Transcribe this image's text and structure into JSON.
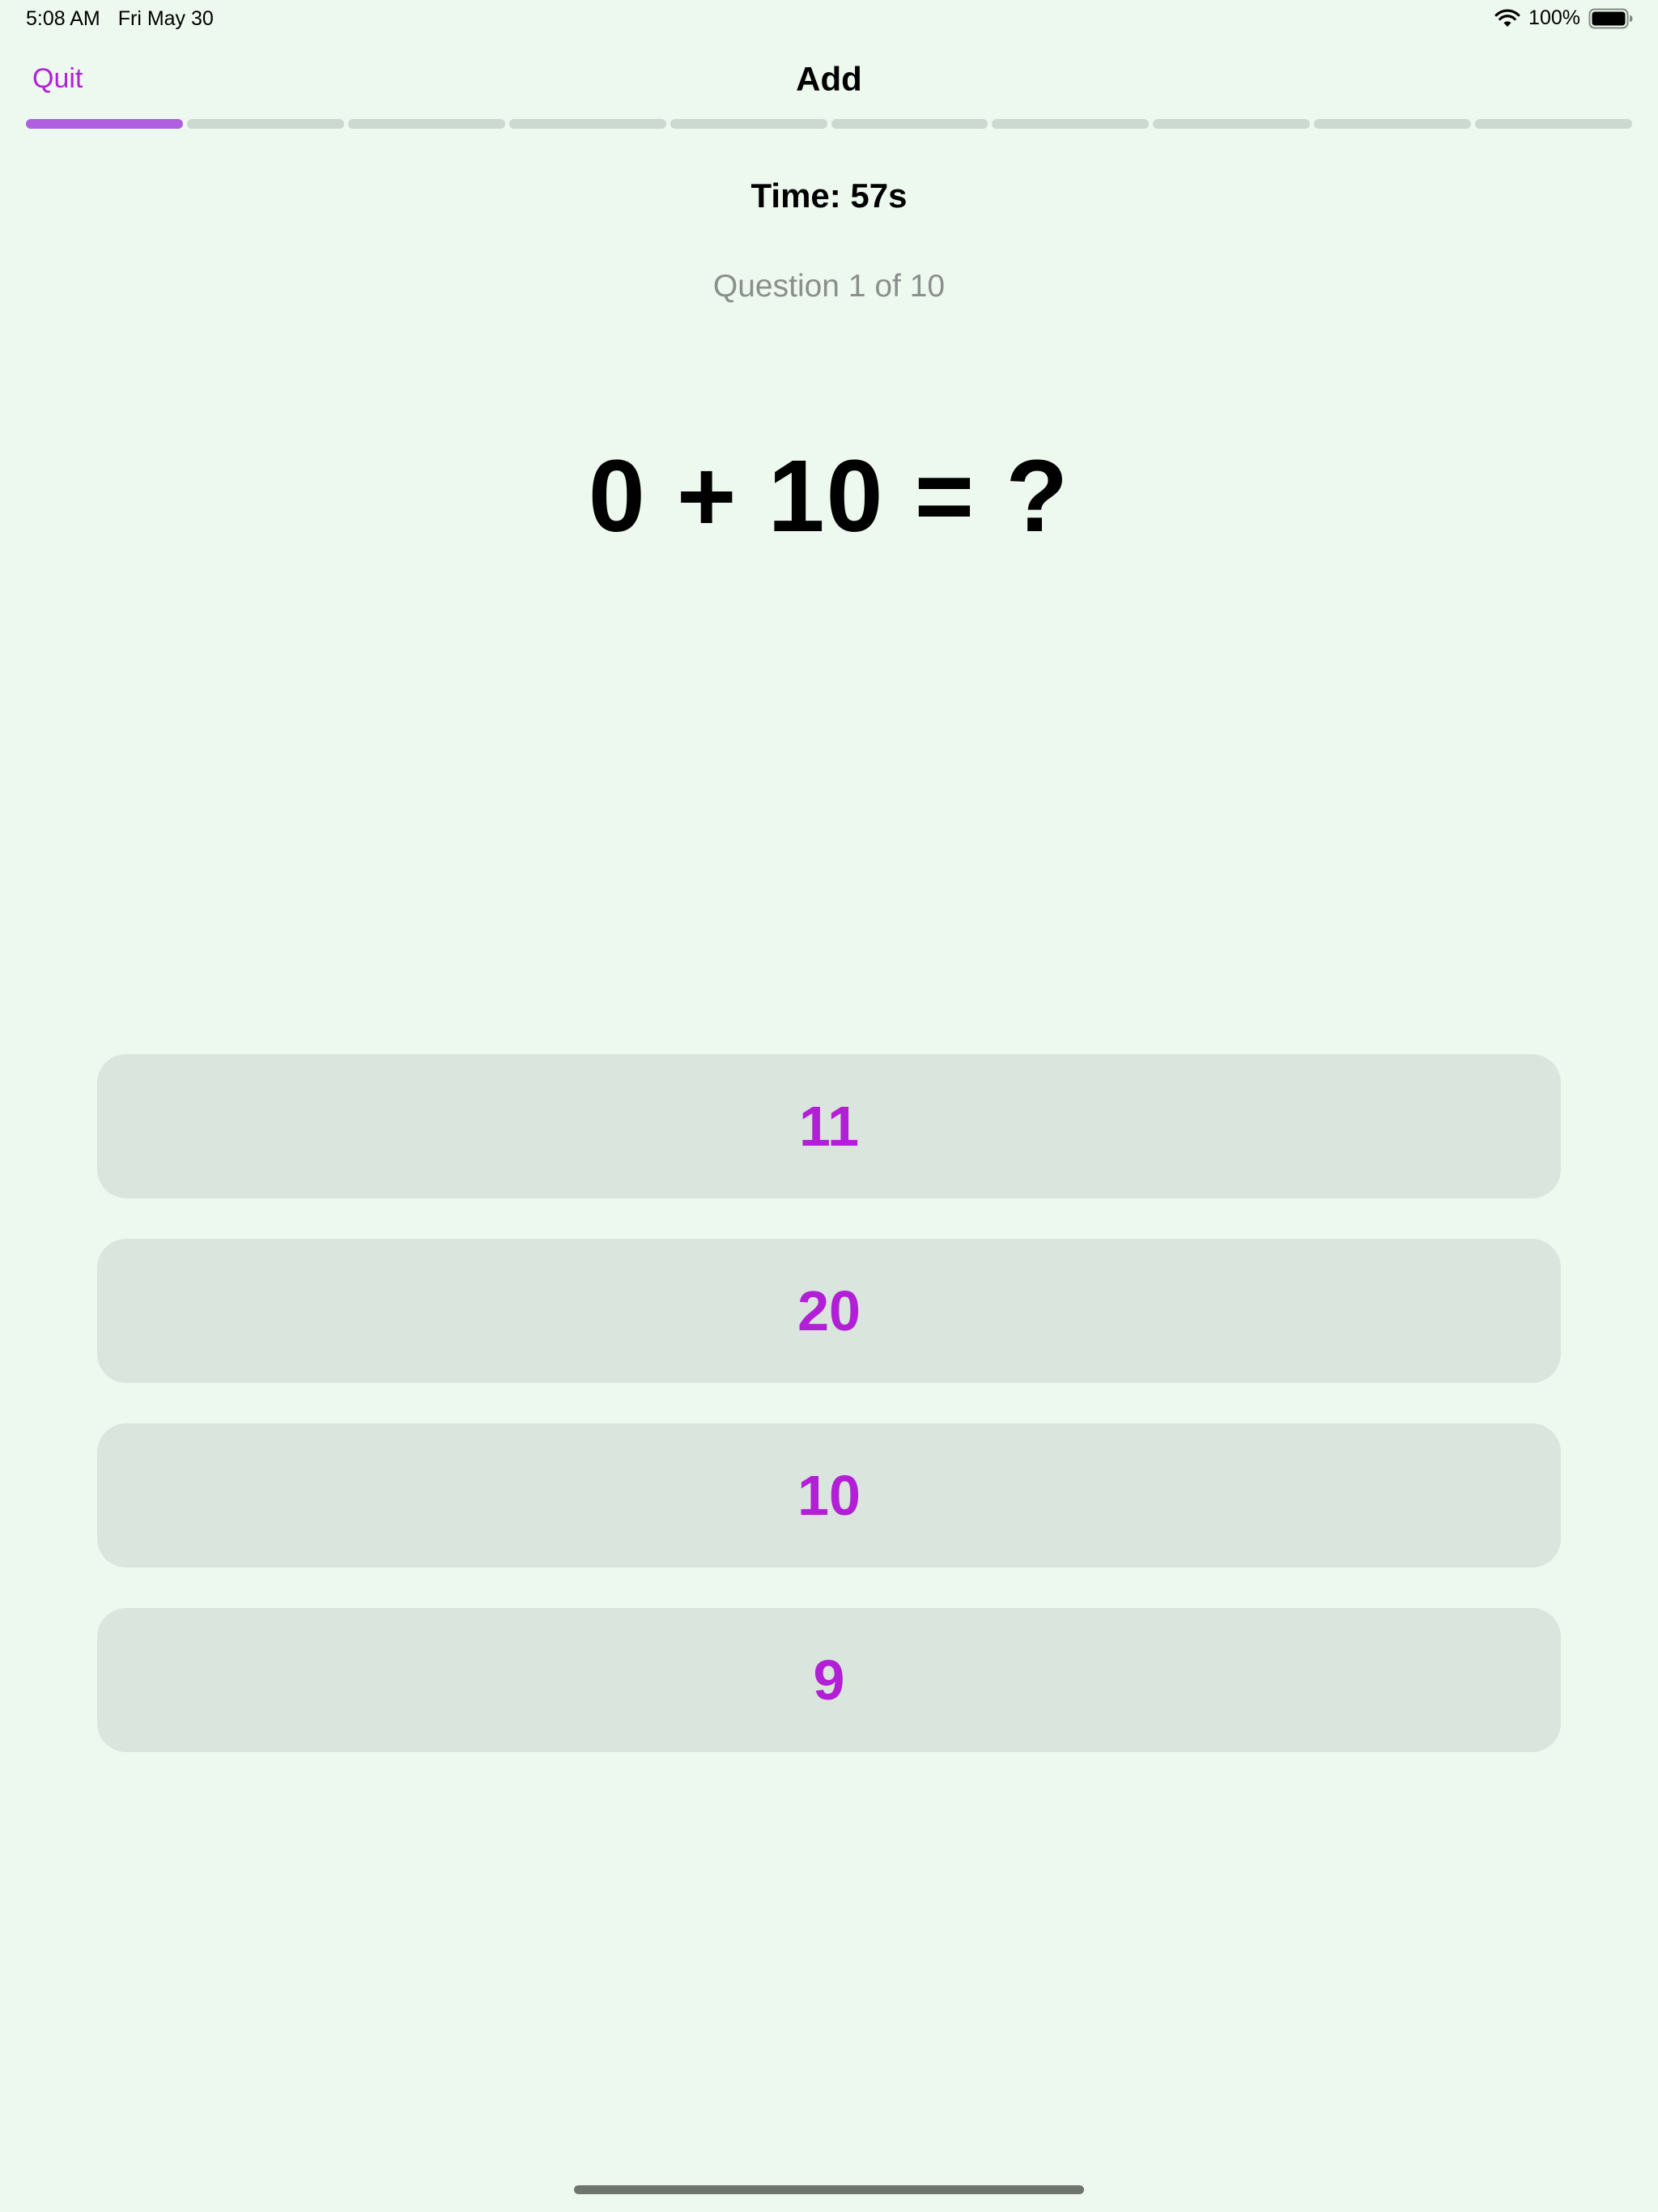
{
  "status_bar": {
    "time": "5:08 AM",
    "date": "Fri May 30",
    "battery": "100%",
    "wifi_icon": "wifi-icon",
    "battery_icon": "battery-icon"
  },
  "nav": {
    "quit_label": "Quit",
    "title": "Add"
  },
  "progress": {
    "total_segments": 10,
    "completed_segments": 1
  },
  "quiz": {
    "timer": "Time: 57s",
    "question_count": "Question 1 of 10",
    "problem": "0 + 10 = ?"
  },
  "answers": [
    "11",
    "20",
    "10",
    "9"
  ],
  "colors": {
    "background": "#edf9ef",
    "accent": "#b21fd6",
    "progress_fill": "#b05fe0",
    "progress_track": "#cbd9d0",
    "answer_button_bg": "#d9e5dd"
  }
}
